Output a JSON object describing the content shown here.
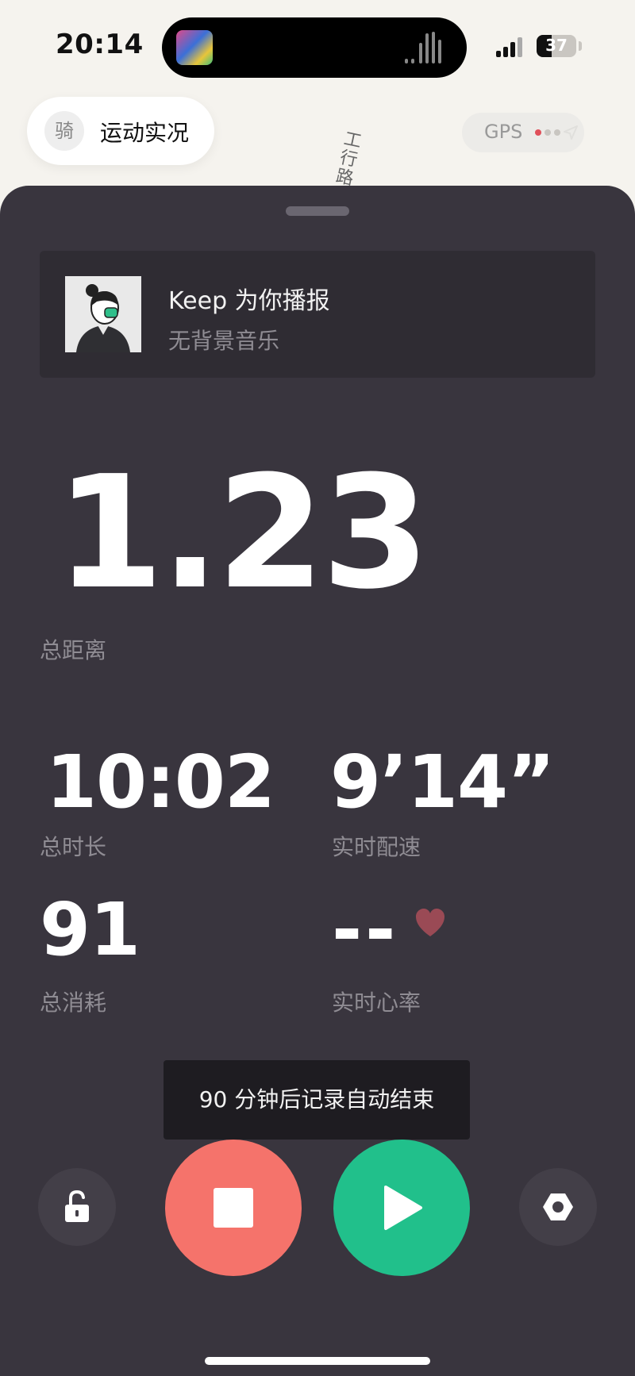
{
  "status_bar": {
    "time": "20:14",
    "battery": "37",
    "battery_percent": 37
  },
  "dynamic_island": {
    "art_icon": "album-art-icon",
    "wave_icon": "audio-wave-icon"
  },
  "top_bar": {
    "sport_icon_char": "骑",
    "sport_label": "运动实况",
    "gps_label": "GPS",
    "gps_signal_colors": [
      "#e0505a",
      "#c9c6c1",
      "#c9c6c1"
    ],
    "map_road_label": "工行路"
  },
  "music_card": {
    "title": "Keep 为你播报",
    "subtitle": "无背景音乐",
    "avatar_icon": "coach-avatar-icon"
  },
  "stats": {
    "distance_value": "1.23",
    "distance_label": "总距离",
    "duration_value": "10:02",
    "duration_label": "总时长",
    "pace_value": "9’14”",
    "pace_label": "实时配速",
    "calories_value": "91",
    "calories_label": "总消耗",
    "heart_value": "--",
    "heart_label": "实时心率"
  },
  "toast": {
    "text": "90 分钟后记录自动结束"
  },
  "controls": {
    "lock_icon": "unlock-icon",
    "stop_icon": "stop-icon",
    "play_icon": "play-icon",
    "settings_icon": "hexagon-settings-icon"
  },
  "colors": {
    "sheet_bg": "#39353e",
    "stop": "#f5736b",
    "play": "#21c08b",
    "heart": "#9a4a55"
  }
}
